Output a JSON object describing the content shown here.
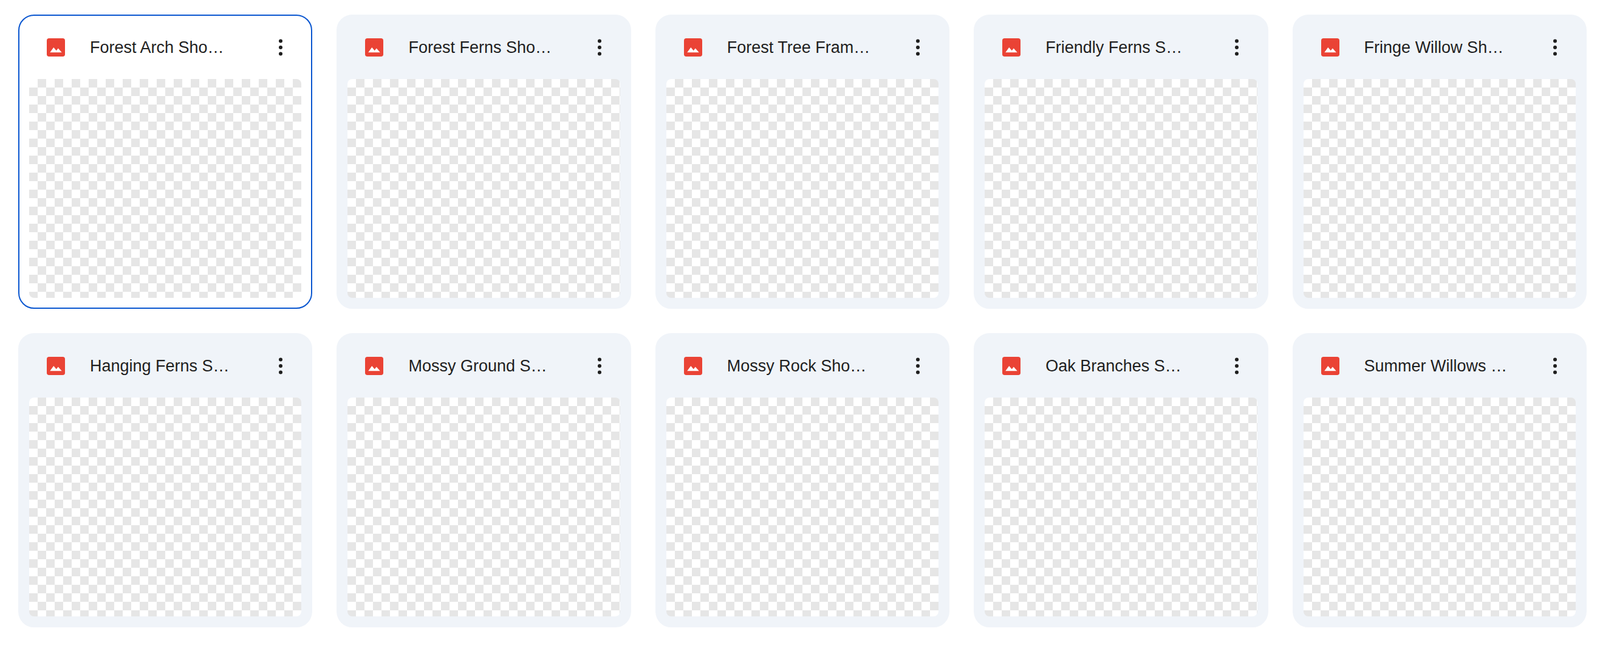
{
  "files": [
    {
      "name": "Forest Arch Sho…",
      "selected": true
    },
    {
      "name": "Forest Ferns Sho…",
      "selected": false
    },
    {
      "name": "Forest Tree Fram…",
      "selected": false
    },
    {
      "name": "Friendly Ferns S…",
      "selected": false
    },
    {
      "name": "Fringe Willow Sh…",
      "selected": false
    },
    {
      "name": "Hanging Ferns S…",
      "selected": false
    },
    {
      "name": "Mossy Ground S…",
      "selected": false
    },
    {
      "name": "Mossy Rock Sho…",
      "selected": false
    },
    {
      "name": "Oak Branches S…",
      "selected": false
    },
    {
      "name": "Summer Willows …",
      "selected": false
    }
  ]
}
